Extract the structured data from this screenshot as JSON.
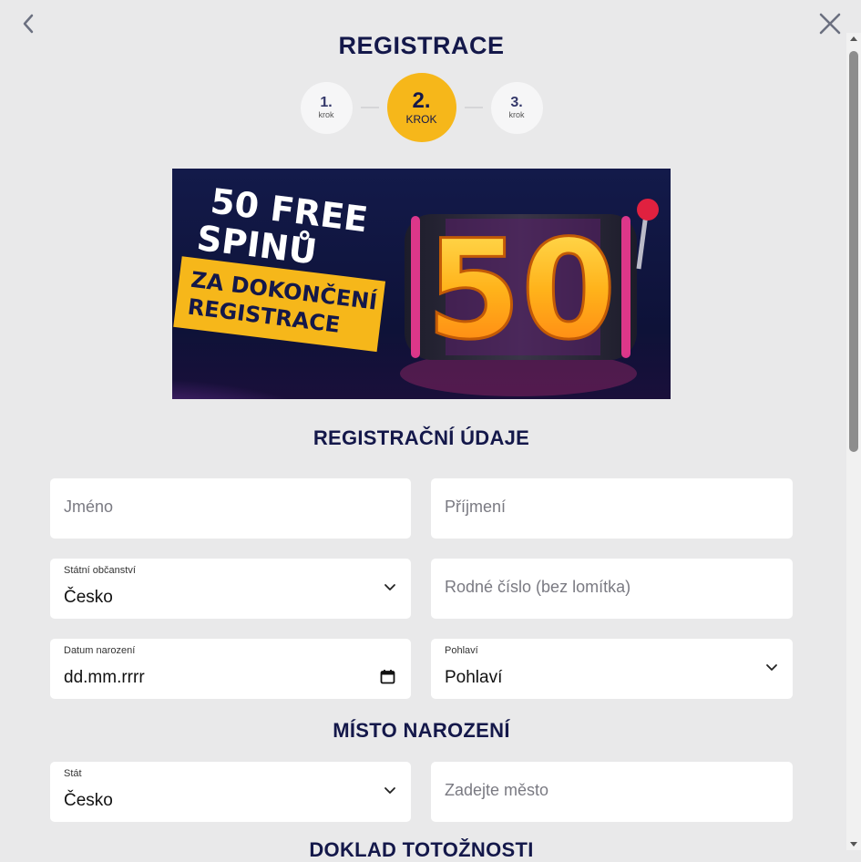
{
  "header": {
    "title": "REGISTRACE",
    "back_icon": "chevron-left-icon",
    "close_icon": "close-icon"
  },
  "steps": [
    {
      "num": "1.",
      "label": "krok",
      "active": false
    },
    {
      "num": "2.",
      "label": "KROK",
      "active": true
    },
    {
      "num": "3.",
      "label": "krok",
      "active": false
    }
  ],
  "banner": {
    "line1": "50 FREE",
    "line2": "SPINŮ",
    "ribbon1": "ZA DOKONČENÍ",
    "ribbon2": "REGISTRACE",
    "big_number": "50"
  },
  "sections": {
    "registration": "REGISTRAČNÍ ÚDAJE",
    "birthplace": "MÍSTO NAROZENÍ",
    "id_doc": "DOKLAD TOTOŽNOSTI"
  },
  "fields": {
    "first_name": {
      "placeholder": "Jméno"
    },
    "last_name": {
      "placeholder": "Příjmení"
    },
    "citizenship": {
      "label": "Státní občanství",
      "value": "Česko"
    },
    "birth_number": {
      "placeholder": "Rodné číslo (bez lomítka)"
    },
    "birth_date": {
      "label": "Datum narození",
      "value": "dd.mm.rrrr"
    },
    "gender": {
      "label": "Pohlaví",
      "value": "Pohlaví"
    },
    "birth_country": {
      "label": "Stát",
      "value": "Česko"
    },
    "birth_city": {
      "placeholder": "Zadejte město"
    }
  },
  "colors": {
    "accent": "#f6b71a",
    "navy": "#14184a",
    "background": "#e9e9ea"
  }
}
